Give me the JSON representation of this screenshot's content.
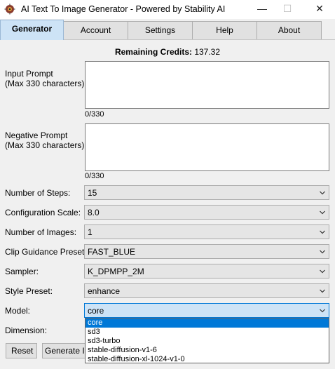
{
  "window": {
    "title": "AI Text To Image Generator - Powered by Stability AI",
    "minimize_glyph": "—",
    "maximize_glyph": "☐",
    "close_glyph": "✕"
  },
  "tabs": [
    {
      "label": "Generator",
      "active": true
    },
    {
      "label": "Account",
      "active": false
    },
    {
      "label": "Settings",
      "active": false
    },
    {
      "label": "Help",
      "active": false
    },
    {
      "label": "About",
      "active": false
    }
  ],
  "credits": {
    "label": "Remaining Credits:",
    "value": "137.32"
  },
  "input_prompt": {
    "label_line1": "Input Prompt",
    "label_line2": "(Max 330 characters):",
    "value": "",
    "counter": "0/330"
  },
  "negative_prompt": {
    "label_line1": "Negative Prompt",
    "label_line2": "(Max 330 characters):",
    "value": "",
    "counter": "0/330"
  },
  "fields": {
    "steps": {
      "label": "Number of Steps:",
      "value": "15"
    },
    "config_scale": {
      "label": "Configuration Scale:",
      "value": "8.0"
    },
    "num_images": {
      "label": "Number of Images:",
      "value": "1"
    },
    "clip_preset": {
      "label": "Clip Guidance Preset:",
      "value": "FAST_BLUE"
    },
    "sampler": {
      "label": "Sampler:",
      "value": "K_DPMPP_2M"
    },
    "style_preset": {
      "label": "Style Preset:",
      "value": "enhance"
    },
    "model": {
      "label": "Model:",
      "value": "core"
    },
    "dimension": {
      "label": "Dimension:"
    }
  },
  "model_options": [
    "core",
    "sd3",
    "sd3-turbo",
    "stable-diffusion-v1-6",
    "stable-diffusion-xl-1024-v1-0"
  ],
  "buttons": {
    "reset": "Reset",
    "generate": "Generate Images"
  },
  "colors": {
    "active_tab": "#cde3f6",
    "selection": "#0078d7"
  }
}
